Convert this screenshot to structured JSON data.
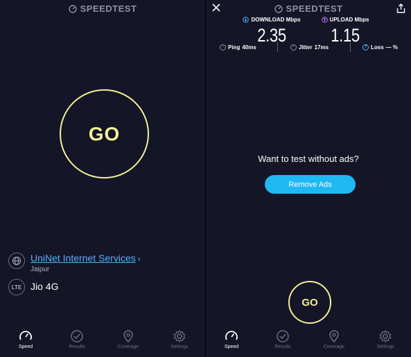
{
  "left": {
    "title": "SPEEDTEST",
    "go_label": "GO",
    "provider": {
      "name": "UniNet Internet Services",
      "location": "Jaipur",
      "chevron": "›"
    },
    "connection": {
      "badge": "LTE",
      "network": "Jio 4G"
    },
    "nav": [
      {
        "label": "Speed",
        "icon": "speedometer-icon",
        "active": true
      },
      {
        "label": "Results",
        "icon": "checkmark-circle-icon",
        "active": false
      },
      {
        "label": "Coverage",
        "icon": "map-pin-icon",
        "active": false
      },
      {
        "label": "Settings",
        "icon": "gear-icon",
        "active": false
      }
    ]
  },
  "right": {
    "title": "SPEEDTEST",
    "download": {
      "label": "DOWNLOAD Mbps",
      "value": "2.35",
      "color": "#4bb7ff"
    },
    "upload": {
      "label": "UPLOAD Mbps",
      "value": "1.15",
      "color": "#c47dff"
    },
    "ping": {
      "label": "Ping",
      "value": "40ms"
    },
    "jitter": {
      "label": "Jitter",
      "value": "17ms"
    },
    "loss": {
      "label": "Loss",
      "value": "— %"
    },
    "ads_question": "Want to test without ads?",
    "remove_ads": "Remove Ads",
    "go_label": "GO",
    "nav": [
      {
        "label": "Speed",
        "icon": "speedometer-icon",
        "active": true
      },
      {
        "label": "Results",
        "icon": "checkmark-circle-icon",
        "active": false
      },
      {
        "label": "Coverage",
        "icon": "map-pin-icon",
        "active": false
      },
      {
        "label": "Settings",
        "icon": "gear-icon",
        "active": false
      }
    ]
  },
  "colors": {
    "background": "#141526",
    "go_ring": "#f5f19a",
    "accent": "#1fb8f2",
    "link": "#4bb7ff"
  }
}
